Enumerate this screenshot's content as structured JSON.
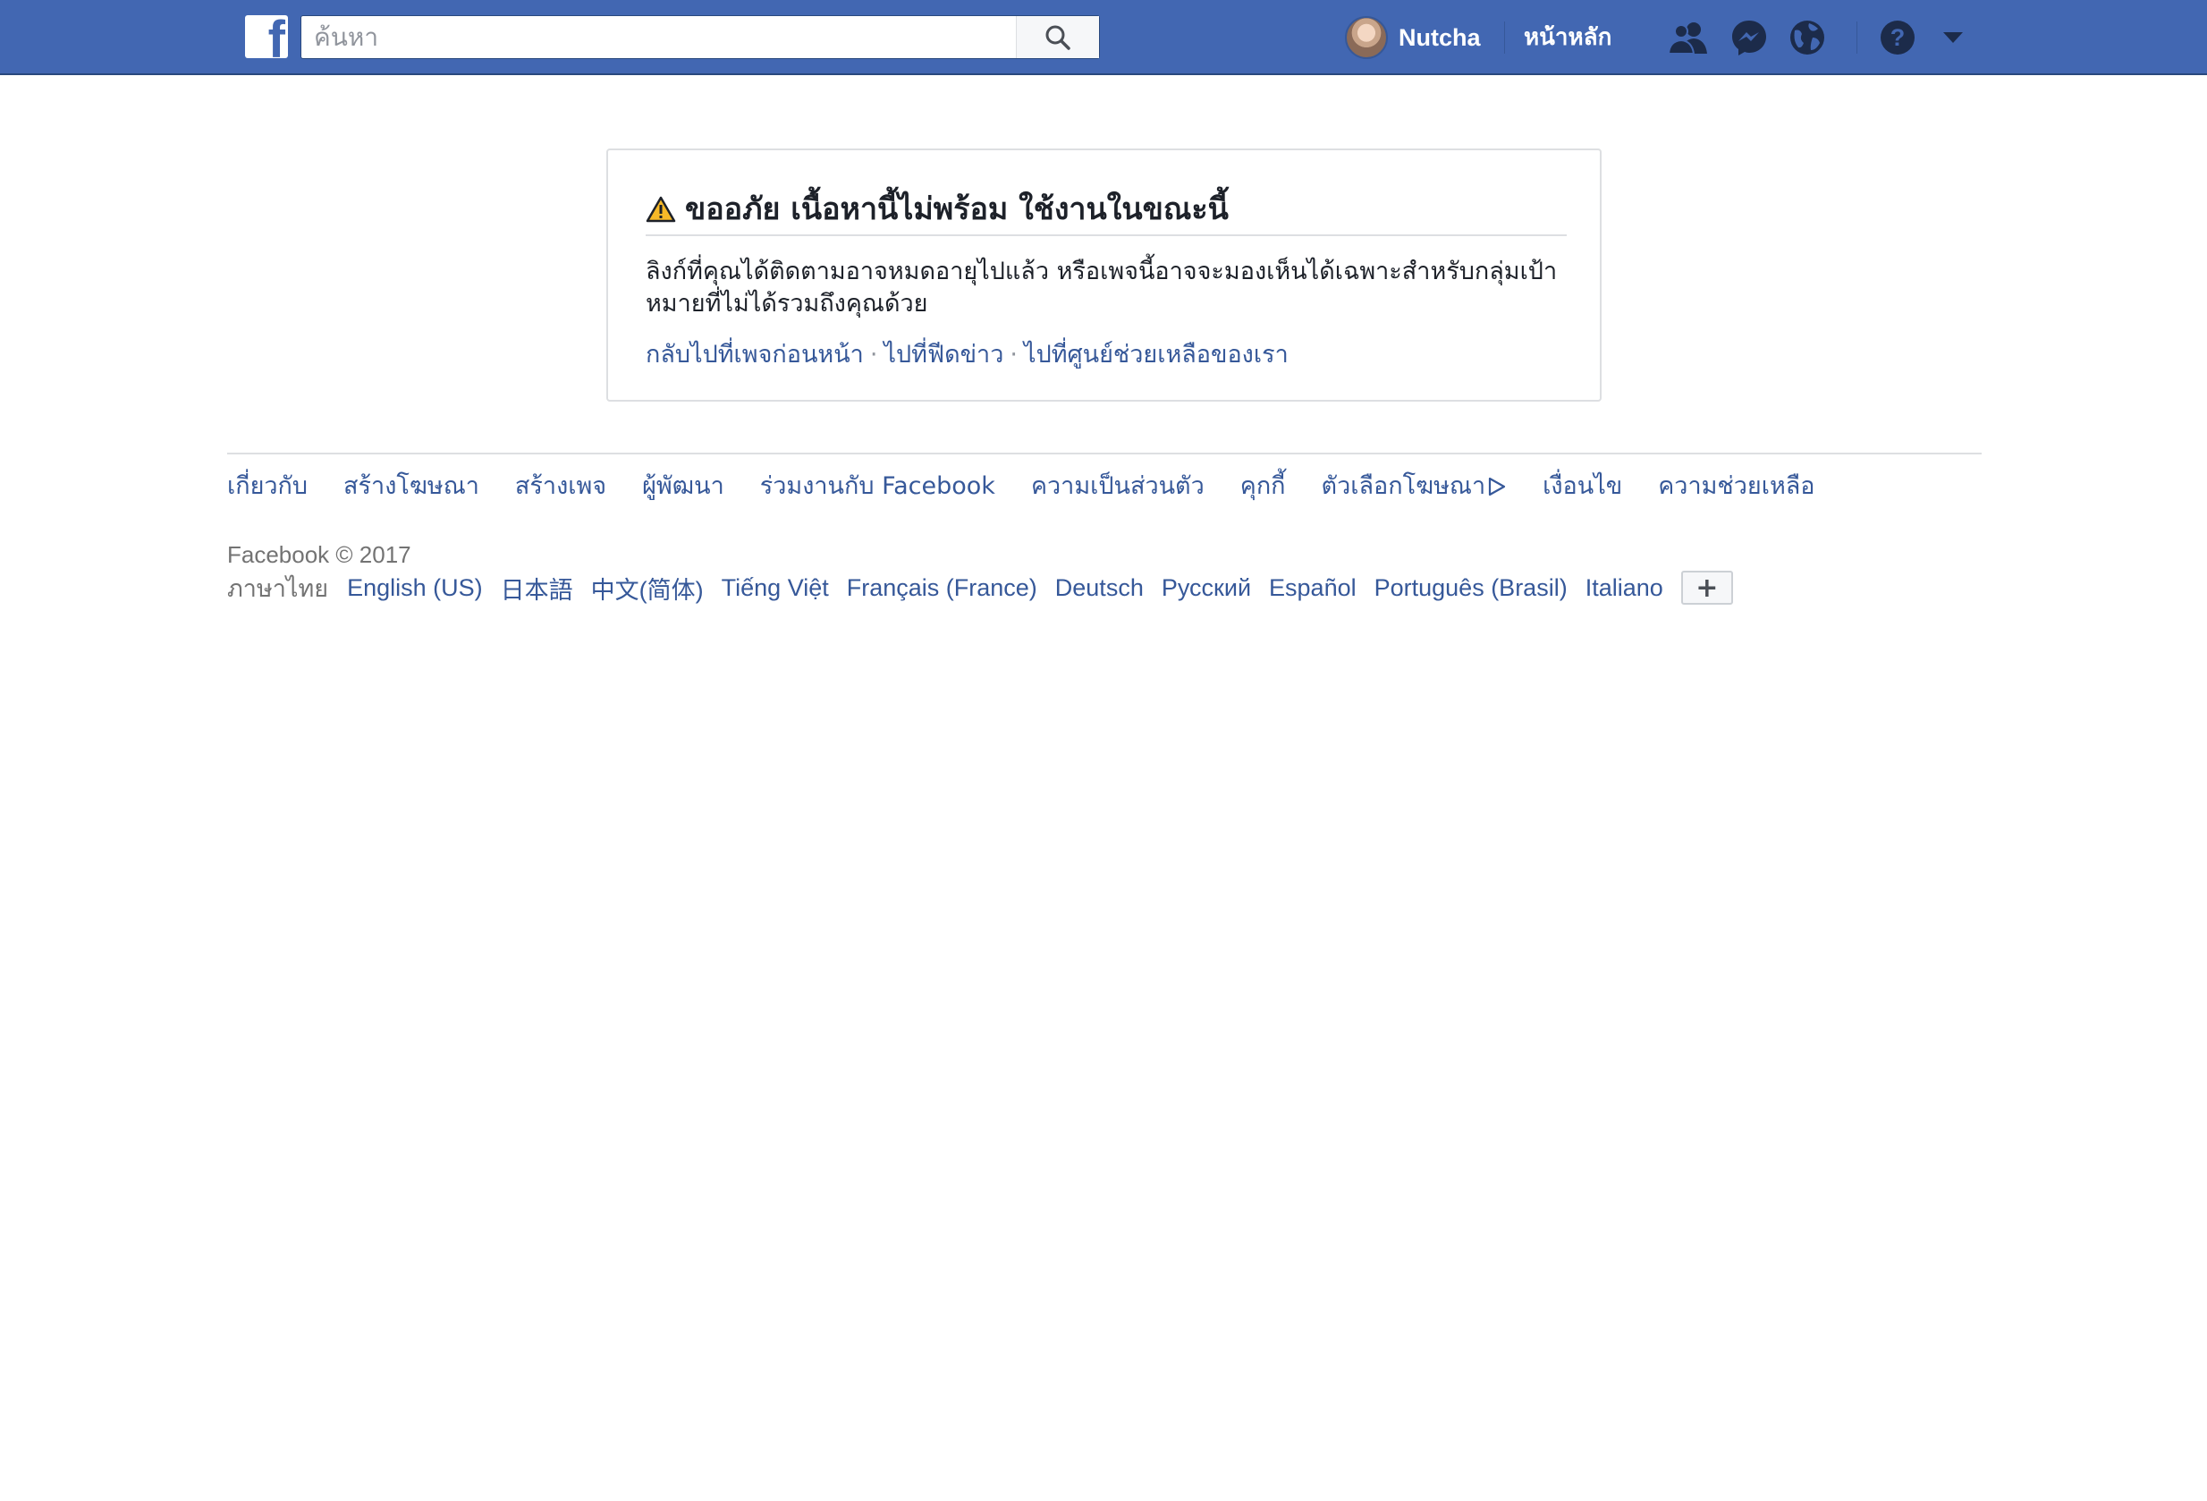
{
  "topbar": {
    "logo": "f",
    "search_placeholder": "ค้นหา",
    "user_name": "Nutcha",
    "home_label": "หน้าหลัก",
    "icons": [
      "facebook-logo",
      "search-icon",
      "friend-requests-icon",
      "messenger-icon",
      "notifications-globe-icon",
      "help-icon",
      "account-menu-caret-icon"
    ]
  },
  "error_card": {
    "title": "ขออภัย เนื้อหานี้ไม่พร้อม ใช้งานในขณะนี้",
    "body_line1": "ลิงก์ที่คุณได้ติดตามอาจหมดอายุไปแล้ว หรือเพจนี้อาจจะมองเห็นได้เฉพาะสำหรับกลุ่มเป้า",
    "body_line2": "หมายที่ไม่ได้รวมถึงคุณด้วย",
    "links": [
      "กลับไปที่เพจก่อนหน้า",
      "ไปที่ฟีดข่าว",
      "ไปที่ศูนย์ช่วยเหลือของเรา"
    ],
    "separator": "·"
  },
  "footer": {
    "links": [
      "เกี่ยวกับ",
      "สร้างโฆษณา",
      "สร้างเพจ",
      "ผู้พัฒนา",
      "ร่วมงานกับ Facebook",
      "ความเป็นส่วนตัว",
      "คุกกี้",
      "ตัวเลือกโฆษณา",
      "เงื่อนไข",
      "ความช่วยเหลือ"
    ],
    "copyright": "Facebook © 2017",
    "current_language": "ภาษาไทย",
    "languages": [
      "English (US)",
      "日本語",
      "中文(简体)",
      "Tiếng Việt",
      "Français (France)",
      "Deutsch",
      "Русский",
      "Español",
      "Português (Brasil)",
      "Italiano"
    ],
    "more_button": "+"
  },
  "colors": {
    "brand_blue": "#4267b2",
    "link_blue": "#365899",
    "border_gray": "#dddfe2",
    "warning_yellow": "#f7b928"
  }
}
